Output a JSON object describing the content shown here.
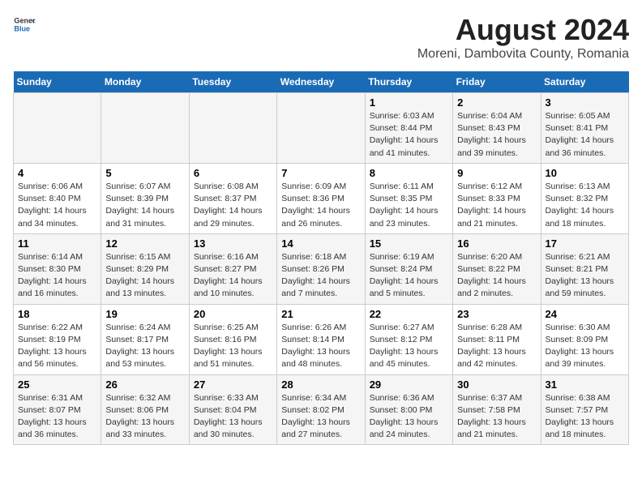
{
  "header": {
    "logo_general": "General",
    "logo_blue": "Blue",
    "main_title": "August 2024",
    "sub_title": "Moreni, Dambovita County, Romania"
  },
  "weekdays": [
    "Sunday",
    "Monday",
    "Tuesday",
    "Wednesday",
    "Thursday",
    "Friday",
    "Saturday"
  ],
  "weeks": [
    [
      {
        "day": "",
        "info": ""
      },
      {
        "day": "",
        "info": ""
      },
      {
        "day": "",
        "info": ""
      },
      {
        "day": "",
        "info": ""
      },
      {
        "day": "1",
        "info": "Sunrise: 6:03 AM\nSunset: 8:44 PM\nDaylight: 14 hours\nand 41 minutes."
      },
      {
        "day": "2",
        "info": "Sunrise: 6:04 AM\nSunset: 8:43 PM\nDaylight: 14 hours\nand 39 minutes."
      },
      {
        "day": "3",
        "info": "Sunrise: 6:05 AM\nSunset: 8:41 PM\nDaylight: 14 hours\nand 36 minutes."
      }
    ],
    [
      {
        "day": "4",
        "info": "Sunrise: 6:06 AM\nSunset: 8:40 PM\nDaylight: 14 hours\nand 34 minutes."
      },
      {
        "day": "5",
        "info": "Sunrise: 6:07 AM\nSunset: 8:39 PM\nDaylight: 14 hours\nand 31 minutes."
      },
      {
        "day": "6",
        "info": "Sunrise: 6:08 AM\nSunset: 8:37 PM\nDaylight: 14 hours\nand 29 minutes."
      },
      {
        "day": "7",
        "info": "Sunrise: 6:09 AM\nSunset: 8:36 PM\nDaylight: 14 hours\nand 26 minutes."
      },
      {
        "day": "8",
        "info": "Sunrise: 6:11 AM\nSunset: 8:35 PM\nDaylight: 14 hours\nand 23 minutes."
      },
      {
        "day": "9",
        "info": "Sunrise: 6:12 AM\nSunset: 8:33 PM\nDaylight: 14 hours\nand 21 minutes."
      },
      {
        "day": "10",
        "info": "Sunrise: 6:13 AM\nSunset: 8:32 PM\nDaylight: 14 hours\nand 18 minutes."
      }
    ],
    [
      {
        "day": "11",
        "info": "Sunrise: 6:14 AM\nSunset: 8:30 PM\nDaylight: 14 hours\nand 16 minutes."
      },
      {
        "day": "12",
        "info": "Sunrise: 6:15 AM\nSunset: 8:29 PM\nDaylight: 14 hours\nand 13 minutes."
      },
      {
        "day": "13",
        "info": "Sunrise: 6:16 AM\nSunset: 8:27 PM\nDaylight: 14 hours\nand 10 minutes."
      },
      {
        "day": "14",
        "info": "Sunrise: 6:18 AM\nSunset: 8:26 PM\nDaylight: 14 hours\nand 7 minutes."
      },
      {
        "day": "15",
        "info": "Sunrise: 6:19 AM\nSunset: 8:24 PM\nDaylight: 14 hours\nand 5 minutes."
      },
      {
        "day": "16",
        "info": "Sunrise: 6:20 AM\nSunset: 8:22 PM\nDaylight: 14 hours\nand 2 minutes."
      },
      {
        "day": "17",
        "info": "Sunrise: 6:21 AM\nSunset: 8:21 PM\nDaylight: 13 hours\nand 59 minutes."
      }
    ],
    [
      {
        "day": "18",
        "info": "Sunrise: 6:22 AM\nSunset: 8:19 PM\nDaylight: 13 hours\nand 56 minutes."
      },
      {
        "day": "19",
        "info": "Sunrise: 6:24 AM\nSunset: 8:17 PM\nDaylight: 13 hours\nand 53 minutes."
      },
      {
        "day": "20",
        "info": "Sunrise: 6:25 AM\nSunset: 8:16 PM\nDaylight: 13 hours\nand 51 minutes."
      },
      {
        "day": "21",
        "info": "Sunrise: 6:26 AM\nSunset: 8:14 PM\nDaylight: 13 hours\nand 48 minutes."
      },
      {
        "day": "22",
        "info": "Sunrise: 6:27 AM\nSunset: 8:12 PM\nDaylight: 13 hours\nand 45 minutes."
      },
      {
        "day": "23",
        "info": "Sunrise: 6:28 AM\nSunset: 8:11 PM\nDaylight: 13 hours\nand 42 minutes."
      },
      {
        "day": "24",
        "info": "Sunrise: 6:30 AM\nSunset: 8:09 PM\nDaylight: 13 hours\nand 39 minutes."
      }
    ],
    [
      {
        "day": "25",
        "info": "Sunrise: 6:31 AM\nSunset: 8:07 PM\nDaylight: 13 hours\nand 36 minutes."
      },
      {
        "day": "26",
        "info": "Sunrise: 6:32 AM\nSunset: 8:06 PM\nDaylight: 13 hours\nand 33 minutes."
      },
      {
        "day": "27",
        "info": "Sunrise: 6:33 AM\nSunset: 8:04 PM\nDaylight: 13 hours\nand 30 minutes."
      },
      {
        "day": "28",
        "info": "Sunrise: 6:34 AM\nSunset: 8:02 PM\nDaylight: 13 hours\nand 27 minutes."
      },
      {
        "day": "29",
        "info": "Sunrise: 6:36 AM\nSunset: 8:00 PM\nDaylight: 13 hours\nand 24 minutes."
      },
      {
        "day": "30",
        "info": "Sunrise: 6:37 AM\nSunset: 7:58 PM\nDaylight: 13 hours\nand 21 minutes."
      },
      {
        "day": "31",
        "info": "Sunrise: 6:38 AM\nSunset: 7:57 PM\nDaylight: 13 hours\nand 18 minutes."
      }
    ]
  ]
}
